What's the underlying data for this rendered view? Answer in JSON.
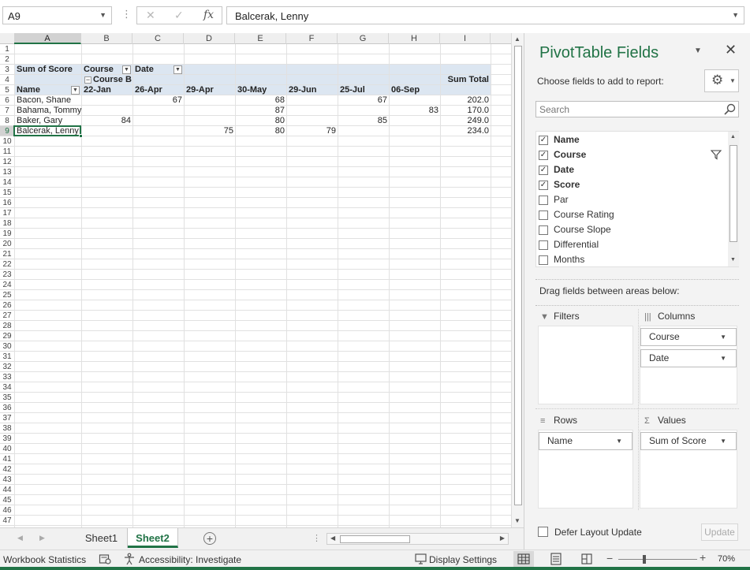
{
  "formula_bar": {
    "name_box": "A9",
    "formula": "Balcerak, Lenny"
  },
  "grid": {
    "columns": [
      "A",
      "B",
      "C",
      "D",
      "E",
      "F",
      "G",
      "H",
      "I"
    ],
    "selected_column": "A",
    "selected_row": "9",
    "row_numbers": [
      "1",
      "2",
      "3",
      "4",
      "5",
      "6",
      "7",
      "8",
      "9",
      "10",
      "11",
      "12",
      "13",
      "14",
      "15",
      "16",
      "17",
      "18",
      "19",
      "20",
      "21",
      "22",
      "23",
      "24",
      "25",
      "26",
      "27",
      "28",
      "29",
      "30",
      "31",
      "32",
      "33",
      "34",
      "35",
      "36",
      "37",
      "38",
      "39",
      "40",
      "41",
      "42",
      "43",
      "44",
      "45",
      "46",
      "47"
    ],
    "pivot": {
      "sum_label": "Sum of Score",
      "course_label": "Course",
      "date_label": "Date",
      "course_value": "Course B",
      "name_label": "Name",
      "dates": [
        "22-Jan",
        "26-Apr",
        "29-Apr",
        "30-May",
        "29-Jun",
        "25-Jul",
        "06-Sep"
      ],
      "sum_total_label": "Sum Total",
      "rows": [
        {
          "name": "Bacon, Shane",
          "cells": [
            "",
            "67",
            "",
            "68",
            "",
            "67",
            ""
          ],
          "total": "202.0"
        },
        {
          "name": "Bahama, Tommy",
          "cells": [
            "",
            "",
            "",
            "87",
            "",
            "",
            "83"
          ],
          "total": "170.0"
        },
        {
          "name": "Baker, Gary",
          "cells": [
            "84",
            "",
            "",
            "80",
            "",
            "85",
            ""
          ],
          "total": "249.0"
        },
        {
          "name": "Balcerak, Lenny",
          "cells": [
            "",
            "",
            "75",
            "80",
            "79",
            "",
            ""
          ],
          "total": "234.0"
        }
      ]
    }
  },
  "sheet_tabs": {
    "tabs": [
      "Sheet1",
      "Sheet2"
    ],
    "active": "Sheet2"
  },
  "pivot_pane": {
    "title": "PivotTable Fields",
    "choose_label": "Choose fields to add to report:",
    "search_placeholder": "Search",
    "fields": [
      {
        "label": "Name",
        "checked": true
      },
      {
        "label": "Course",
        "checked": true,
        "filtered": true
      },
      {
        "label": "Date",
        "checked": true
      },
      {
        "label": "Score",
        "checked": true
      },
      {
        "label": "Par",
        "checked": false
      },
      {
        "label": "Course Rating",
        "checked": false
      },
      {
        "label": "Course Slope",
        "checked": false
      },
      {
        "label": "Differential",
        "checked": false
      },
      {
        "label": "Months",
        "checked": false
      }
    ],
    "drag_label": "Drag fields between areas below:",
    "areas": {
      "filters": {
        "title": "Filters",
        "items": []
      },
      "columns": {
        "title": "Columns",
        "items": [
          "Course",
          "Date"
        ]
      },
      "rows": {
        "title": "Rows",
        "items": [
          "Name"
        ]
      },
      "values": {
        "title": "Values",
        "items": [
          "Sum of Score"
        ]
      }
    },
    "defer_label": "Defer Layout Update",
    "update_label": "Update"
  },
  "status_bar": {
    "workbook_statistics": "Workbook Statistics",
    "accessibility": "Accessibility: Investigate",
    "display_settings": "Display Settings",
    "zoom": "70%",
    "zoom_level": 0.7
  },
  "colors": {
    "accent": "#217346",
    "pivot_band": "#dce6f1",
    "pane_title": "#217346"
  }
}
